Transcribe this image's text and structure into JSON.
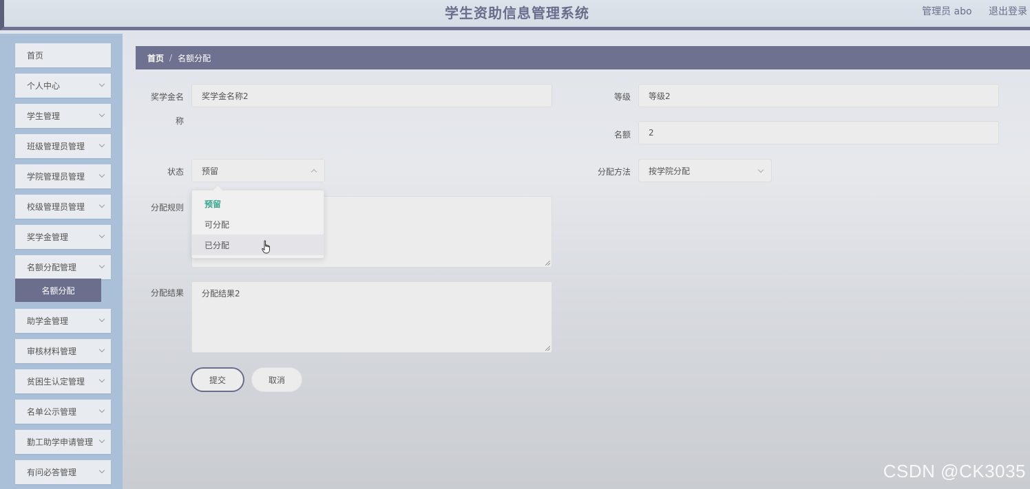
{
  "header": {
    "title": "学生资助信息管理系统",
    "user": "管理员 abo",
    "logout": "退出登录"
  },
  "sidebar": {
    "items": [
      {
        "label": "首页"
      },
      {
        "label": "个人中心"
      },
      {
        "label": "学生管理"
      },
      {
        "label": "班级管理员管理"
      },
      {
        "label": "学院管理员管理"
      },
      {
        "label": "校级管理员管理"
      },
      {
        "label": "奖学金管理"
      },
      {
        "label": "名额分配管理"
      },
      {
        "label": "助学金管理"
      },
      {
        "label": "审核材料管理"
      },
      {
        "label": "贫困生认定管理"
      },
      {
        "label": "名单公示管理"
      },
      {
        "label": "勤工助学申请管理"
      },
      {
        "label": "有问必答管理"
      }
    ],
    "active_sub": "名额分配"
  },
  "breadcrumb": {
    "home": "首页",
    "separator": "/",
    "current": "名额分配"
  },
  "form": {
    "scholarship_name_label_line1": "奖学金名",
    "scholarship_name_label_line2": "称",
    "scholarship_name_value": "奖学金名称2",
    "level_label": "等级",
    "level_value": "等级2",
    "quota_label": "名额",
    "quota_value": "2",
    "status_label": "状态",
    "status_value": "预留",
    "method_label": "分配方法",
    "method_value": "按学院分配",
    "rule_label": "分配规则",
    "rule_value": "",
    "result_label": "分配结果",
    "result_value": "分配结果2",
    "submit": "提交",
    "cancel": "取消"
  },
  "status_dropdown": {
    "options": [
      "预留",
      "可分配",
      "已分配"
    ],
    "selected": "预留",
    "hovered": "已分配"
  },
  "colors": {
    "accent": "#6f7191",
    "selected_option": "#3aa68e",
    "sidebar_bg": "#a9c0d8"
  },
  "watermark": "CSDN @CK3035"
}
